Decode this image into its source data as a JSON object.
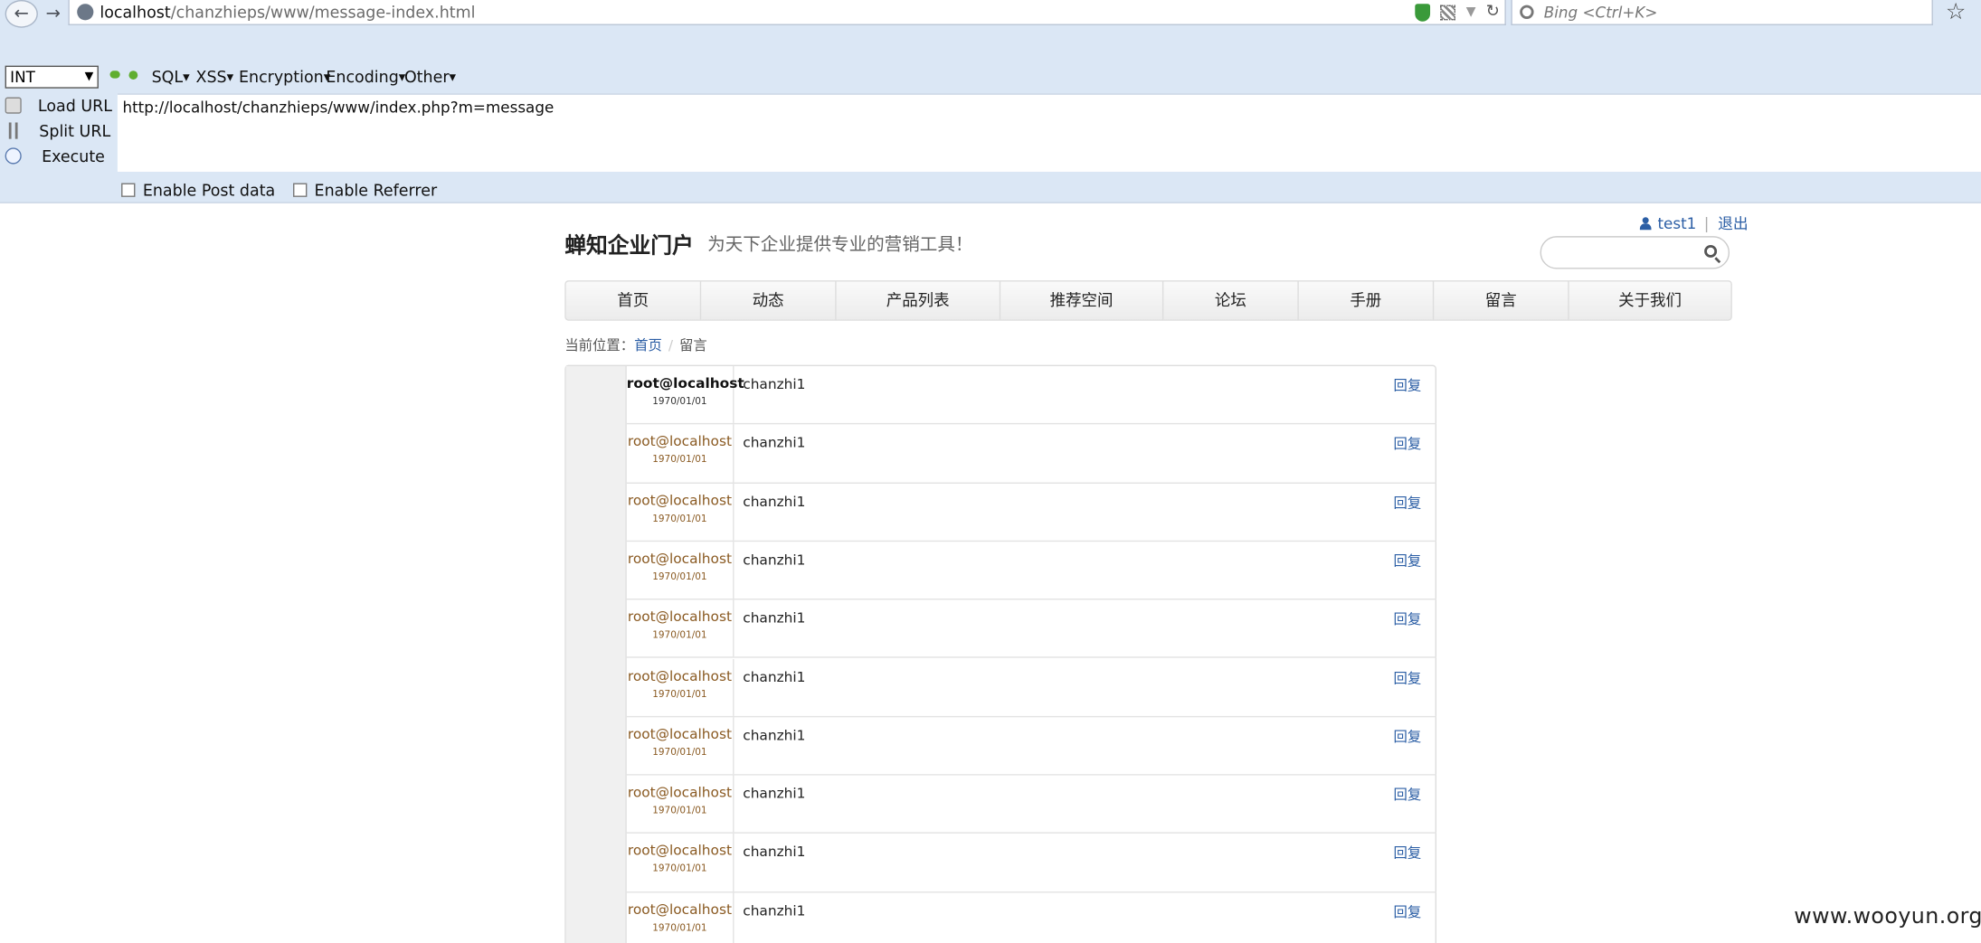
{
  "browser": {
    "url_host": "localhost",
    "url_path": "/chanzhieps/www/message-index.html",
    "search_placeholder": "Bing <Ctrl+K>"
  },
  "hackbar": {
    "select_value": "INT",
    "menus": [
      "SQL",
      "XSS",
      "Encryption",
      "Encoding",
      "Other"
    ],
    "load_url_label": "Load URL",
    "split_url_label": "Split URL",
    "execute_label": "Execute",
    "url_value": "http://localhost/chanzhieps/www/index.php?m=message",
    "enable_post_label": "Enable Post data",
    "enable_referrer_label": "Enable Referrer"
  },
  "site": {
    "user_name": "test1",
    "logout_label": "退出",
    "logo": "蝉知企业门户",
    "slogan": "为天下企业提供专业的营销工具！",
    "nav": [
      "首页",
      "动态",
      "产品列表",
      "推荐空间",
      "论坛",
      "手册",
      "留言",
      "关于我们"
    ],
    "breadcrumb_prefix": "当前位置：",
    "breadcrumb_home": "首页",
    "breadcrumb_current": "留言"
  },
  "messages": [
    {
      "author": "root@localhost",
      "date": "1970/01/01",
      "content": "chanzhi1",
      "reply": "回复"
    },
    {
      "author": "root@localhost",
      "date": "1970/01/01",
      "content": "chanzhi1",
      "reply": "回复"
    },
    {
      "author": "root@localhost",
      "date": "1970/01/01",
      "content": "chanzhi1",
      "reply": "回复"
    },
    {
      "author": "root@localhost",
      "date": "1970/01/01",
      "content": "chanzhi1",
      "reply": "回复"
    },
    {
      "author": "root@localhost",
      "date": "1970/01/01",
      "content": "chanzhi1",
      "reply": "回复"
    },
    {
      "author": "root@localhost",
      "date": "1970/01/01",
      "content": "chanzhi1",
      "reply": "回复"
    },
    {
      "author": "root@localhost",
      "date": "1970/01/01",
      "content": "chanzhi1",
      "reply": "回复"
    },
    {
      "author": "root@localhost",
      "date": "1970/01/01",
      "content": "chanzhi1",
      "reply": "回复"
    },
    {
      "author": "root@localhost",
      "date": "1970/01/01",
      "content": "chanzhi1",
      "reply": "回复"
    },
    {
      "author": "root@localhost",
      "date": "1970/01/01",
      "content": "chanzhi1",
      "reply": "回复"
    }
  ],
  "watermark": "www.wooyun.org"
}
